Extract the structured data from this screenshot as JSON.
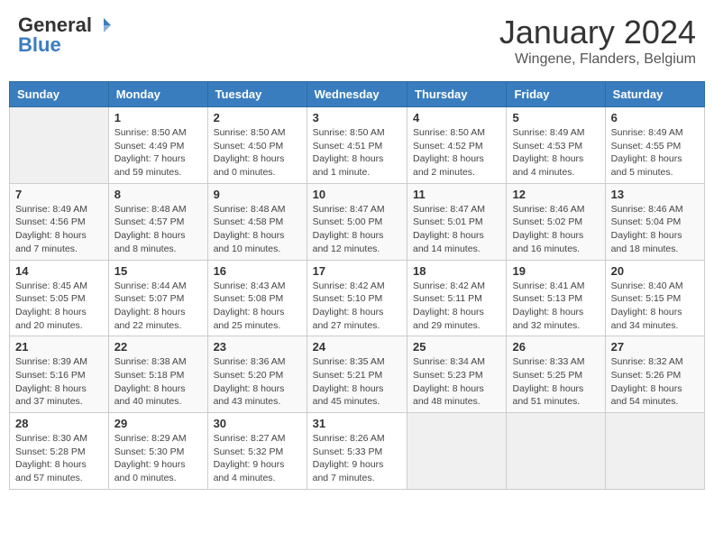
{
  "header": {
    "logo_general": "General",
    "logo_blue": "Blue",
    "month_title": "January 2024",
    "location": "Wingene, Flanders, Belgium"
  },
  "days_of_week": [
    "Sunday",
    "Monday",
    "Tuesday",
    "Wednesday",
    "Thursday",
    "Friday",
    "Saturday"
  ],
  "weeks": [
    [
      {
        "day": "",
        "info": ""
      },
      {
        "day": "1",
        "info": "Sunrise: 8:50 AM\nSunset: 4:49 PM\nDaylight: 7 hours\nand 59 minutes."
      },
      {
        "day": "2",
        "info": "Sunrise: 8:50 AM\nSunset: 4:50 PM\nDaylight: 8 hours\nand 0 minutes."
      },
      {
        "day": "3",
        "info": "Sunrise: 8:50 AM\nSunset: 4:51 PM\nDaylight: 8 hours\nand 1 minute."
      },
      {
        "day": "4",
        "info": "Sunrise: 8:50 AM\nSunset: 4:52 PM\nDaylight: 8 hours\nand 2 minutes."
      },
      {
        "day": "5",
        "info": "Sunrise: 8:49 AM\nSunset: 4:53 PM\nDaylight: 8 hours\nand 4 minutes."
      },
      {
        "day": "6",
        "info": "Sunrise: 8:49 AM\nSunset: 4:55 PM\nDaylight: 8 hours\nand 5 minutes."
      }
    ],
    [
      {
        "day": "7",
        "info": "Sunrise: 8:49 AM\nSunset: 4:56 PM\nDaylight: 8 hours\nand 7 minutes."
      },
      {
        "day": "8",
        "info": "Sunrise: 8:48 AM\nSunset: 4:57 PM\nDaylight: 8 hours\nand 8 minutes."
      },
      {
        "day": "9",
        "info": "Sunrise: 8:48 AM\nSunset: 4:58 PM\nDaylight: 8 hours\nand 10 minutes."
      },
      {
        "day": "10",
        "info": "Sunrise: 8:47 AM\nSunset: 5:00 PM\nDaylight: 8 hours\nand 12 minutes."
      },
      {
        "day": "11",
        "info": "Sunrise: 8:47 AM\nSunset: 5:01 PM\nDaylight: 8 hours\nand 14 minutes."
      },
      {
        "day": "12",
        "info": "Sunrise: 8:46 AM\nSunset: 5:02 PM\nDaylight: 8 hours\nand 16 minutes."
      },
      {
        "day": "13",
        "info": "Sunrise: 8:46 AM\nSunset: 5:04 PM\nDaylight: 8 hours\nand 18 minutes."
      }
    ],
    [
      {
        "day": "14",
        "info": "Sunrise: 8:45 AM\nSunset: 5:05 PM\nDaylight: 8 hours\nand 20 minutes."
      },
      {
        "day": "15",
        "info": "Sunrise: 8:44 AM\nSunset: 5:07 PM\nDaylight: 8 hours\nand 22 minutes."
      },
      {
        "day": "16",
        "info": "Sunrise: 8:43 AM\nSunset: 5:08 PM\nDaylight: 8 hours\nand 25 minutes."
      },
      {
        "day": "17",
        "info": "Sunrise: 8:42 AM\nSunset: 5:10 PM\nDaylight: 8 hours\nand 27 minutes."
      },
      {
        "day": "18",
        "info": "Sunrise: 8:42 AM\nSunset: 5:11 PM\nDaylight: 8 hours\nand 29 minutes."
      },
      {
        "day": "19",
        "info": "Sunrise: 8:41 AM\nSunset: 5:13 PM\nDaylight: 8 hours\nand 32 minutes."
      },
      {
        "day": "20",
        "info": "Sunrise: 8:40 AM\nSunset: 5:15 PM\nDaylight: 8 hours\nand 34 minutes."
      }
    ],
    [
      {
        "day": "21",
        "info": "Sunrise: 8:39 AM\nSunset: 5:16 PM\nDaylight: 8 hours\nand 37 minutes."
      },
      {
        "day": "22",
        "info": "Sunrise: 8:38 AM\nSunset: 5:18 PM\nDaylight: 8 hours\nand 40 minutes."
      },
      {
        "day": "23",
        "info": "Sunrise: 8:36 AM\nSunset: 5:20 PM\nDaylight: 8 hours\nand 43 minutes."
      },
      {
        "day": "24",
        "info": "Sunrise: 8:35 AM\nSunset: 5:21 PM\nDaylight: 8 hours\nand 45 minutes."
      },
      {
        "day": "25",
        "info": "Sunrise: 8:34 AM\nSunset: 5:23 PM\nDaylight: 8 hours\nand 48 minutes."
      },
      {
        "day": "26",
        "info": "Sunrise: 8:33 AM\nSunset: 5:25 PM\nDaylight: 8 hours\nand 51 minutes."
      },
      {
        "day": "27",
        "info": "Sunrise: 8:32 AM\nSunset: 5:26 PM\nDaylight: 8 hours\nand 54 minutes."
      }
    ],
    [
      {
        "day": "28",
        "info": "Sunrise: 8:30 AM\nSunset: 5:28 PM\nDaylight: 8 hours\nand 57 minutes."
      },
      {
        "day": "29",
        "info": "Sunrise: 8:29 AM\nSunset: 5:30 PM\nDaylight: 9 hours\nand 0 minutes."
      },
      {
        "day": "30",
        "info": "Sunrise: 8:27 AM\nSunset: 5:32 PM\nDaylight: 9 hours\nand 4 minutes."
      },
      {
        "day": "31",
        "info": "Sunrise: 8:26 AM\nSunset: 5:33 PM\nDaylight: 9 hours\nand 7 minutes."
      },
      {
        "day": "",
        "info": ""
      },
      {
        "day": "",
        "info": ""
      },
      {
        "day": "",
        "info": ""
      }
    ]
  ]
}
